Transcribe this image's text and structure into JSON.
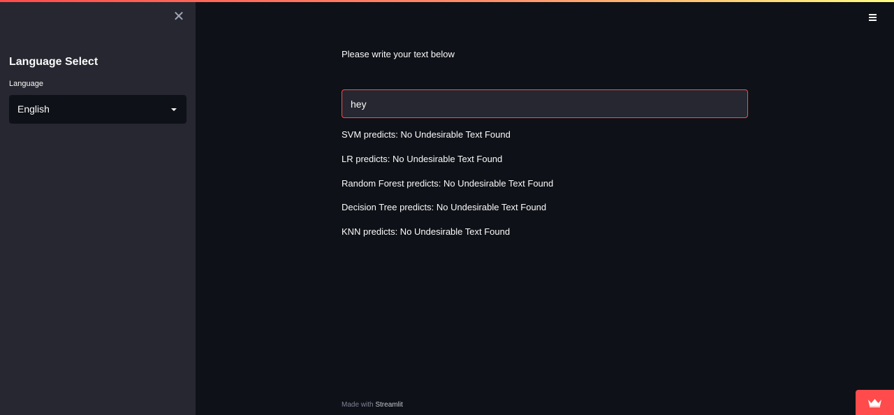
{
  "sidebar": {
    "close_icon": "close-icon",
    "title": "Language Select",
    "language_label": "Language",
    "language_selected": "English"
  },
  "header": {
    "menu_icon": "hamburger-menu-icon",
    "accent_colors": [
      "#ff4b4b",
      "#fffd80"
    ]
  },
  "main": {
    "prompt": "Please write your text below",
    "input_value": "hey",
    "predictions": [
      "SVM predicts: No Undesirable Text Found",
      "LR predicts: No Undesirable Text Found",
      "Random Forest predicts: No Undesirable Text Found",
      "Decision Tree predicts: No Undesirable Text Found",
      "KNN predicts: No Undesirable Text Found"
    ]
  },
  "footer": {
    "made_with": "Made with ",
    "link_text": "Streamlit"
  },
  "badge": {
    "icon": "crown-icon",
    "color": "#ff4b4b"
  },
  "colors": {
    "background": "#0e1117",
    "sidebar_background": "#262730",
    "input_border": "#ff4b4b"
  }
}
